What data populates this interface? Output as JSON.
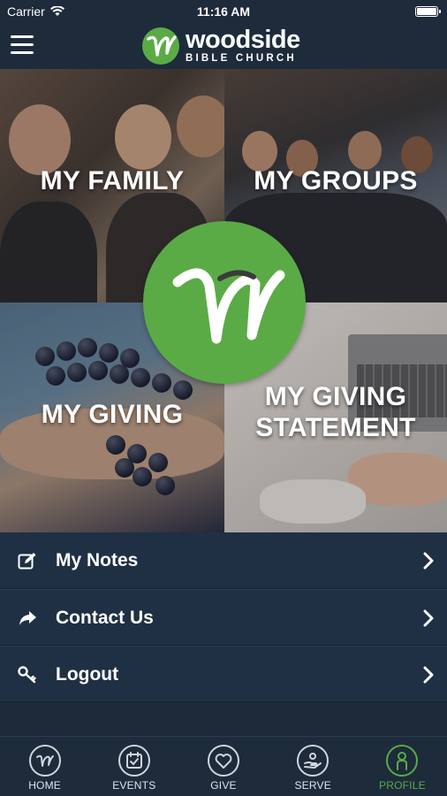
{
  "status_bar": {
    "carrier": "Carrier",
    "time": "11:16 AM"
  },
  "header": {
    "logo_name": "woodside",
    "logo_sub": "BIBLE CHURCH",
    "menu_icon": "hamburger-menu-icon"
  },
  "tiles": [
    {
      "label": "MY FAMILY"
    },
    {
      "label": "MY GROUPS"
    },
    {
      "label": "MY GIVING"
    },
    {
      "label": "MY GIVING STATEMENT"
    }
  ],
  "menu": [
    {
      "label": "My Notes",
      "icon": "edit-note-icon"
    },
    {
      "label": "Contact Us",
      "icon": "share-arrow-icon"
    },
    {
      "label": "Logout",
      "icon": "key-icon"
    }
  ],
  "tabs": [
    {
      "label": "HOME",
      "icon": "home-logo-icon"
    },
    {
      "label": "EVENTS",
      "icon": "calendar-icon"
    },
    {
      "label": "GIVE",
      "icon": "heart-icon"
    },
    {
      "label": "SERVE",
      "icon": "serve-hand-icon"
    },
    {
      "label": "PROFILE",
      "icon": "profile-icon",
      "active": true
    }
  ],
  "colors": {
    "brand_green": "#5aab46",
    "header_bg": "#1d2b3b",
    "list_bg": "#1f3044"
  }
}
